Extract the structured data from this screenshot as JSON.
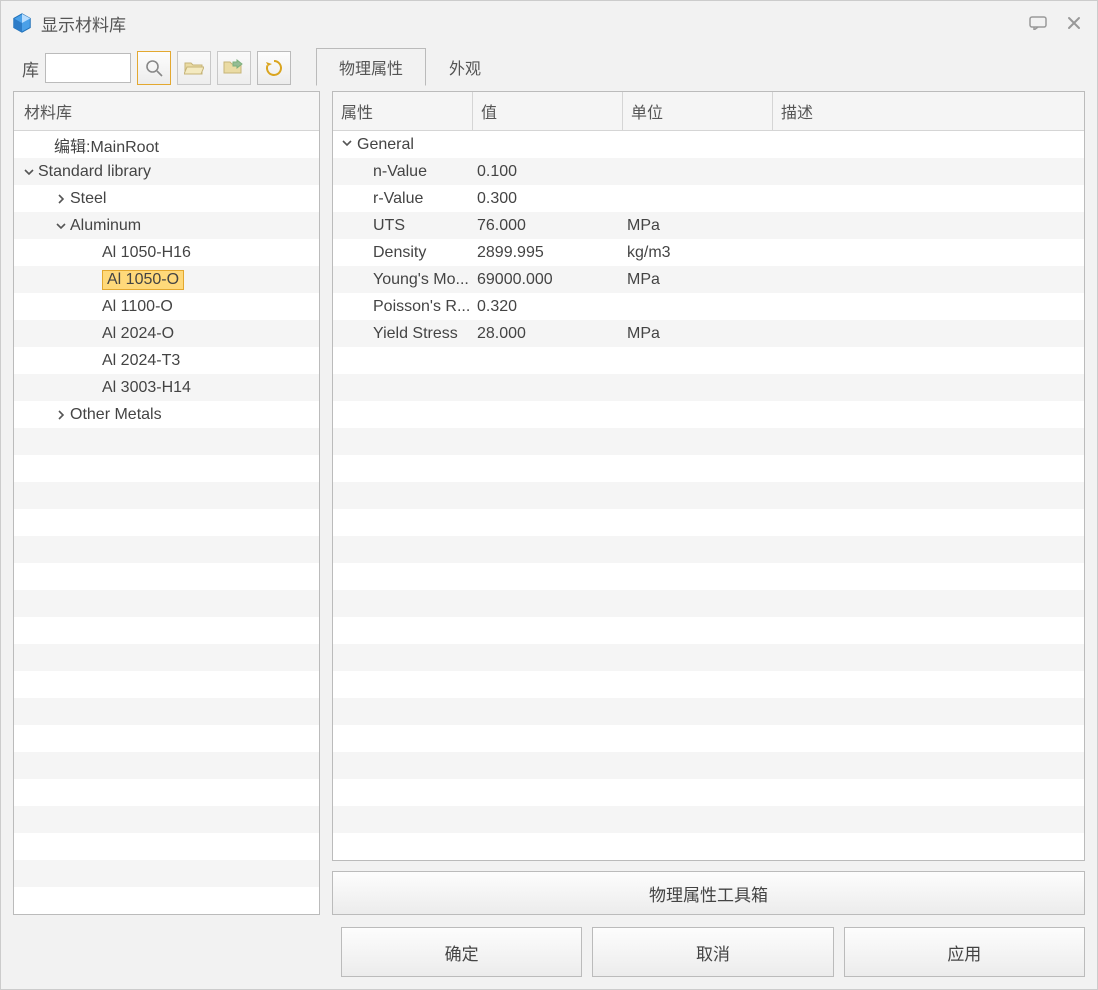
{
  "window": {
    "title": "显示材料库"
  },
  "toolbar": {
    "lib_label": "库"
  },
  "tabs": {
    "physical": "物理属性",
    "appearance": "外观"
  },
  "left": {
    "header": "材料库",
    "tree": [
      {
        "indent": 1,
        "chev": "",
        "label": "编辑:MainRoot"
      },
      {
        "indent": 0,
        "chev": "down",
        "label": "Standard library"
      },
      {
        "indent": 2,
        "chev": "right",
        "label": "Steel"
      },
      {
        "indent": 2,
        "chev": "down",
        "label": "Aluminum"
      },
      {
        "indent": 4,
        "chev": "",
        "label": "Al 1050-H16"
      },
      {
        "indent": 4,
        "chev": "",
        "label": "Al 1050-O",
        "selected": true
      },
      {
        "indent": 4,
        "chev": "",
        "label": "Al 1100-O"
      },
      {
        "indent": 4,
        "chev": "",
        "label": "Al 2024-O"
      },
      {
        "indent": 4,
        "chev": "",
        "label": "Al 2024-T3"
      },
      {
        "indent": 4,
        "chev": "",
        "label": "Al 3003-H14"
      },
      {
        "indent": 2,
        "chev": "right",
        "label": "Other Metals"
      }
    ]
  },
  "grid": {
    "headers": {
      "attr": "属性",
      "val": "值",
      "unit": "单位",
      "desc": "描述"
    },
    "group": "General",
    "rows": [
      {
        "attr": "n-Value",
        "val": "0.100",
        "unit": ""
      },
      {
        "attr": "r-Value",
        "val": "0.300",
        "unit": ""
      },
      {
        "attr": "UTS",
        "val": "76.000",
        "unit": "MPa"
      },
      {
        "attr": "Density",
        "val": "2899.995",
        "unit": "kg/m3"
      },
      {
        "attr": "Young's Mo...",
        "val": "69000.000",
        "unit": "MPa"
      },
      {
        "attr": "Poisson's R...",
        "val": "0.320",
        "unit": ""
      },
      {
        "attr": "Yield Stress",
        "val": "28.000",
        "unit": "MPa"
      }
    ],
    "empty_rows": 22
  },
  "toolbox_label": "物理属性工具箱",
  "buttons": {
    "ok": "确定",
    "cancel": "取消",
    "apply": "应用"
  }
}
